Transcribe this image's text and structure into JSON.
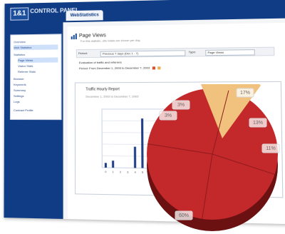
{
  "app": {
    "logo": "1&1",
    "logo_sub": "CONTROL PANEL",
    "tab": "WebStatistics"
  },
  "sidebar": {
    "items": [
      {
        "label": "Overview"
      },
      {
        "label": "Web Statistics",
        "active": true
      },
      {
        "label": "Statistics"
      },
      {
        "label": "Page Views",
        "active": true,
        "sub": true
      },
      {
        "label": "Visitor Stats",
        "sub": true
      },
      {
        "label": "Referrer Stats",
        "sub": true
      },
      {
        "label": "Browser"
      },
      {
        "label": "Keywords"
      },
      {
        "label": "Summary"
      },
      {
        "label": "Settings"
      },
      {
        "label": "Logs"
      },
      {
        "label": "Contract Profile"
      }
    ]
  },
  "main": {
    "title": "Page Views",
    "subtitle": "For this statistic, site totals are shown per day.",
    "filter": {
      "a_label": "Period:",
      "a_value": "Previous 7 days (Dec 1 - 7)",
      "b_label": "Type:",
      "b_value": "Page Views"
    },
    "period_line": "Evaluation of traffic and referrers",
    "period_value": "Period: From December 1, 2003 to December 7, 2003",
    "graph": {
      "title": "Traffic Hourly Report",
      "date": "December 1, 2003 to December 7, 2003"
    }
  },
  "chart_data": {
    "type": "bar",
    "categories": [
      "0",
      "1",
      "2",
      "3",
      "4",
      "5",
      "6",
      "7",
      "8",
      "9",
      "10",
      "11"
    ],
    "values": [
      2,
      3,
      0,
      0,
      9,
      21,
      4,
      5,
      0,
      0,
      0,
      0
    ],
    "ylim": [
      0,
      25
    ],
    "legend_title": "Page Views",
    "colors": {
      "bar": "#213f86",
      "grid": "#cfd6e4"
    }
  },
  "pie": {
    "labels": [
      "17%",
      "3%",
      "3%",
      "13%",
      "11%",
      "60%"
    ],
    "colors": {
      "light": "#f1c27d",
      "dark": "#c3282b",
      "darker": "#8f1b1d",
      "shadow": "#6b1112"
    }
  }
}
